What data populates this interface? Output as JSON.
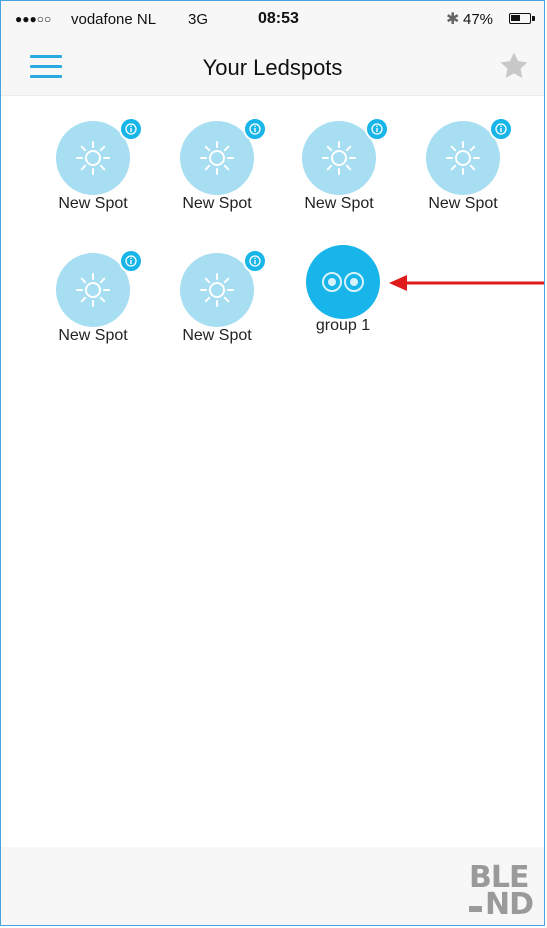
{
  "status_bar": {
    "signal": "●●●○○",
    "carrier": "vodafone NL",
    "network": "3G",
    "time": "08:53",
    "bluetooth_icon": "bluetooth-icon",
    "battery_pct": "47%",
    "battery_level": 0.47
  },
  "nav": {
    "title": "Your Ledspots",
    "menu_icon": "hamburger-menu-icon",
    "star_icon": "star-icon"
  },
  "spots": [
    {
      "label": "New Spot",
      "type": "spot"
    },
    {
      "label": "New Spot",
      "type": "spot"
    },
    {
      "label": "New Spot",
      "type": "spot"
    },
    {
      "label": "New Spot",
      "type": "spot"
    },
    {
      "label": "New Spot",
      "type": "spot"
    },
    {
      "label": "New Spot",
      "type": "spot"
    }
  ],
  "group": {
    "label": "group 1",
    "type": "group"
  },
  "annotation": {
    "arrow_color": "#e01b1b",
    "points_to": "group 1"
  },
  "footer": {
    "logo_line1": "BLE",
    "logo_line2": "ND"
  },
  "colors": {
    "accent": "#29a9e0",
    "spot_circle": "#a7def2",
    "group_circle": "#17b5ea",
    "info_badge": "#18b5e8"
  }
}
